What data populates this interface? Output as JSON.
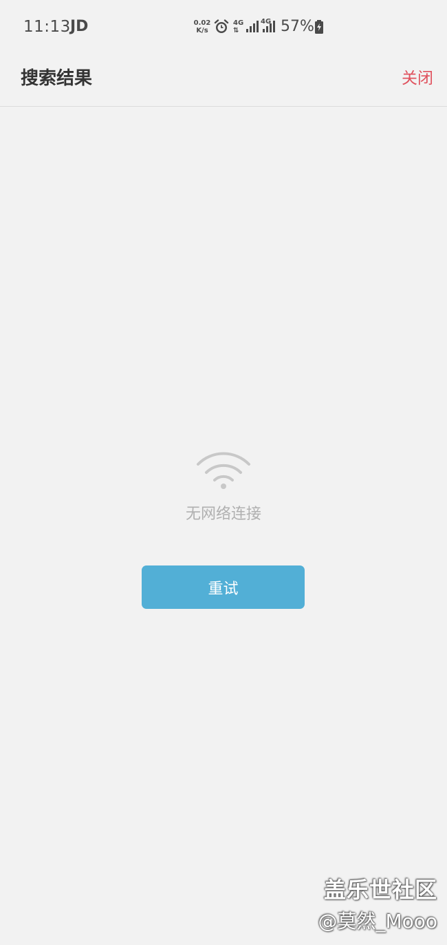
{
  "status_bar": {
    "time": "11:13",
    "carrier_icon": "JD",
    "net_speed_value": "0.02",
    "net_speed_unit": "K/s",
    "net1": "4G",
    "net2": "4G",
    "battery": "57%",
    "battery_icon_glyph": "7"
  },
  "header": {
    "title": "搜索结果",
    "close_label": "关闭"
  },
  "empty_state": {
    "icon": "wifi-icon",
    "message": "无网络连接",
    "retry_label": "重试"
  },
  "watermark": {
    "brand": "盖乐世社区",
    "author": "@莫然_Mooo"
  },
  "colors": {
    "background": "#f2f2f2",
    "close_accent": "#e0525e",
    "retry_button": "#52afd6",
    "message_text": "#b0b0b0"
  }
}
